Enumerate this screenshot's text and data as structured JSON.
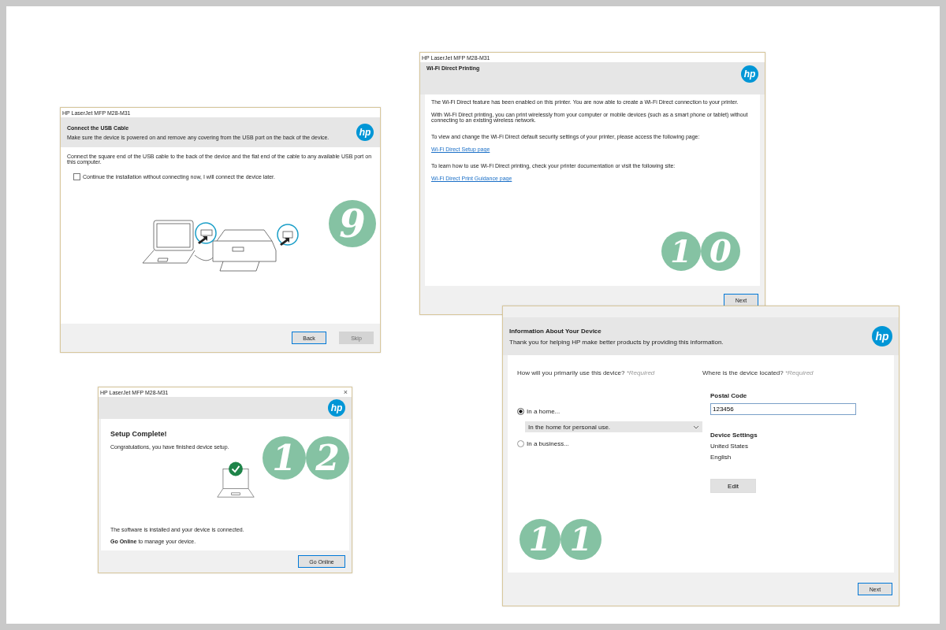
{
  "windows": [
    {
      "kind": "usb",
      "title": "HP LaserJet MFP M28-M31",
      "logo": "hp",
      "heading": "Connect the USB Cable",
      "subtitle": "Make sure the device is powered on and remove any covering from the USB port on the back of the device.",
      "body": "Connect the square end of the USB cable to the back of the device and the flat end of the cable to any available USB port on this computer.",
      "checkbox": {
        "label": "Continue the installation without connecting now, I will connect the device later.",
        "checked": false
      },
      "buttons": [
        {
          "label": "Back",
          "disabled": false
        },
        {
          "label": "Skip",
          "disabled": true
        }
      ],
      "step": [
        "9"
      ]
    },
    {
      "kind": "wifi",
      "title": "HP LaserJet MFP M28-M31",
      "logo": "hp",
      "heading": "Wi-Fi Direct Printing",
      "groups": [
        [
          {
            "kind": "text",
            "text": "The Wi-Fi Direct feature has been enabled on this printer. You are now able to create a Wi-Fi Direct connection to your printer."
          },
          {
            "kind": "text",
            "text": "With Wi-Fi Direct printing, you can print wirelessly from your computer or mobile devices (such as a smart phone or tablet) without connecting to an existing wireless network."
          }
        ],
        [
          {
            "kind": "text",
            "text": "To view and change the Wi-Fi Direct default security settings of your printer, please access the following page:"
          },
          {
            "kind": "link",
            "text": "Wi-Fi Direct Setup page"
          }
        ],
        [
          {
            "kind": "text",
            "text": "To learn how to use Wi-Fi Direct printing, check your printer documentation or visit the following site:"
          },
          {
            "kind": "link",
            "text": "Wi-Fi Direct Print Guidance page"
          }
        ]
      ],
      "buttons": [
        {
          "label": "Next",
          "disabled": false
        }
      ],
      "step": [
        "1",
        "0"
      ]
    },
    {
      "kind": "complete",
      "title": "HP LaserJet MFP M28-M31",
      "close": "×",
      "logo": "hp",
      "heading": "Setup Complete!",
      "message": "Congratulations, you have finished device setup.",
      "status": "The software is installed and your device is connected.",
      "online_note": "**Go Online** to manage your device.",
      "buttons": [
        {
          "label": "Go Online",
          "disabled": false
        }
      ],
      "step": [
        "1",
        "2"
      ]
    },
    {
      "kind": "info",
      "logo": "hp",
      "heading": "Information About Your Device",
      "subtitle": "Thank you for helping HP make better products by providing this information.",
      "usage": {
        "question": "How will you primarily use this device?",
        "required": "*Required",
        "options": [
          {
            "label": "In a home...",
            "selected": true
          },
          {
            "label": "In a business...",
            "selected": false
          }
        ],
        "dropdown": "In the home for personal use."
      },
      "location": {
        "question": "Where is the device located?",
        "required": "*Required",
        "postal_label": "Postal Code",
        "postal_value": "123456",
        "settings_label": "Device Settings",
        "settings": [
          "United States",
          "English"
        ],
        "edit": "Edit"
      },
      "buttons": [
        {
          "label": "Next",
          "disabled": false
        }
      ],
      "step": [
        "1",
        "1"
      ]
    }
  ]
}
